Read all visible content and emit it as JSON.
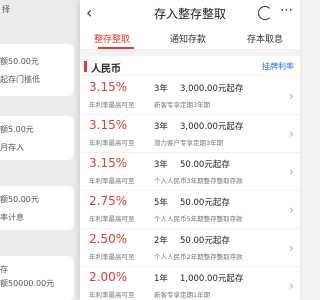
{
  "background": {
    "lines": [
      "择",
      "额50.00元",
      "起存门槛低",
      "额5.00元",
      "月存入",
      "额50.00元",
      "率计息",
      "额50000.00元",
      "存"
    ]
  },
  "nav": {
    "back_icon": "chevron-left-icon",
    "title": "存入整存整取",
    "refresh_icon": "refresh-icon",
    "more_icon": "more-icon"
  },
  "tabs": [
    {
      "label": "整存整取",
      "active": true
    },
    {
      "label": "通知存款",
      "active": false
    },
    {
      "label": "存本取息",
      "active": false
    }
  ],
  "section": {
    "label": "人民币",
    "link": "挂牌利率"
  },
  "products": [
    {
      "rate": "3.15%",
      "rate_note": "年利率最高可至",
      "term": "3年",
      "min": "3,000.00元起存",
      "desc": "新客专享定期3年期"
    },
    {
      "rate": "3.15%",
      "rate_note": "年利率最高可至",
      "term": "3年",
      "min": "3,000.00元起存",
      "desc": "潜力客户专享定期3年期"
    },
    {
      "rate": "3.15%",
      "rate_note": "年利率最高可至",
      "term": "3年",
      "min": "50.00元起存",
      "desc": "个人人民币3年期整存整取存款"
    },
    {
      "rate": "2.75%",
      "rate_note": "年利率最高可至",
      "term": "5年",
      "min": "50.00元起存",
      "desc": "个人人民币5年期整存整取存款"
    },
    {
      "rate": "2.50%",
      "rate_note": "年利率最高可至",
      "term": "2年",
      "min": "50.00元起存",
      "desc": "个人人民币2年期整存整取存款"
    },
    {
      "rate": "2.00%",
      "rate_note": "年利率最高可至",
      "term": "1年",
      "min": "1,000.00元起存",
      "desc": "新客专享定期1年期"
    }
  ],
  "colors": {
    "accent": "#e23b2f",
    "link": "#2a6fd6"
  }
}
